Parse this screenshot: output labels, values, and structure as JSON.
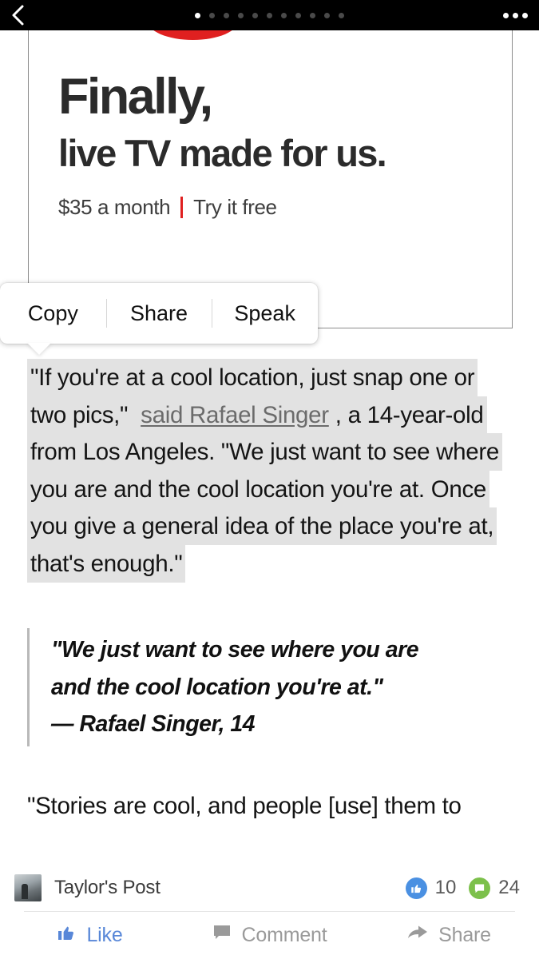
{
  "topbar": {
    "back_icon": "chevron-left-icon",
    "more_icon": "overflow-menu-icon",
    "page_dots_total": 11,
    "page_dots_active_index": 0
  },
  "ad": {
    "headline_line1": "Finally,",
    "headline_line2": "live TV made for us.",
    "price": "$35 a month",
    "cta": "Try it free",
    "accent_color": "#e02020"
  },
  "selection_popup": {
    "items": [
      {
        "label": "Copy"
      },
      {
        "label": "Share"
      },
      {
        "label": "Speak"
      }
    ]
  },
  "article": {
    "paragraph1": {
      "part1": "\"If you're at a cool location, just snap one or two pics,\" ",
      "link": "said Rafael Singer",
      "part2": ", a 14-year-old from Los Angeles. \"We just want to see where you are and the cool location you're at. Once you give a general idea of the place you're at, that's enough.\""
    },
    "pullquote": {
      "line1": "\"We just want to see where you are",
      "line2": "and the cool location you're at.\"",
      "attribution": "— Rafael Singer, 14"
    },
    "paragraph2": "\"Stories are cool, and people [use] them to"
  },
  "postbar": {
    "avatar_icon": "post-thumbnail",
    "title": "Taylor's Post",
    "like_icon": "thumbs-up-icon",
    "like_count": "10",
    "comment_icon": "comment-bubble-icon",
    "comment_count": "24",
    "actions": [
      {
        "label": "Like",
        "icon": "thumbs-up-icon"
      },
      {
        "label": "Comment",
        "icon": "comment-icon"
      },
      {
        "label": "Share",
        "icon": "share-arrow-icon"
      }
    ]
  }
}
